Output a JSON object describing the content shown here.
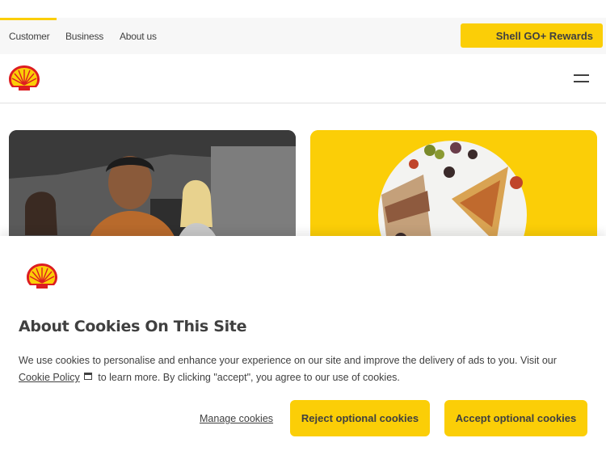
{
  "utility_nav": {
    "items": [
      {
        "label": "Customer"
      },
      {
        "label": "Business"
      },
      {
        "label": "About us"
      }
    ],
    "rewards_label": "Shell GO+ Rewards"
  },
  "cookie_banner": {
    "title": "About Cookies On This Site",
    "text_part1": "We use cookies to personalise and enhance your experience on our site and improve the delivery of ads to you. Visit our",
    "policy_link": "Cookie Policy",
    "text_part2": "to learn more. By clicking \"accept\", you agree to our use of cookies.",
    "manage_label": "Manage cookies",
    "reject_label": "Reject optional cookies",
    "accept_label": "Accept optional cookies"
  },
  "colors": {
    "brand_yellow": "#fbce07",
    "brand_red": "#dd1d21",
    "text": "#404040"
  },
  "icons": {
    "logo": "shell-pecten-logo",
    "menu": "hamburger-menu-icon",
    "external": "external-link-icon"
  }
}
